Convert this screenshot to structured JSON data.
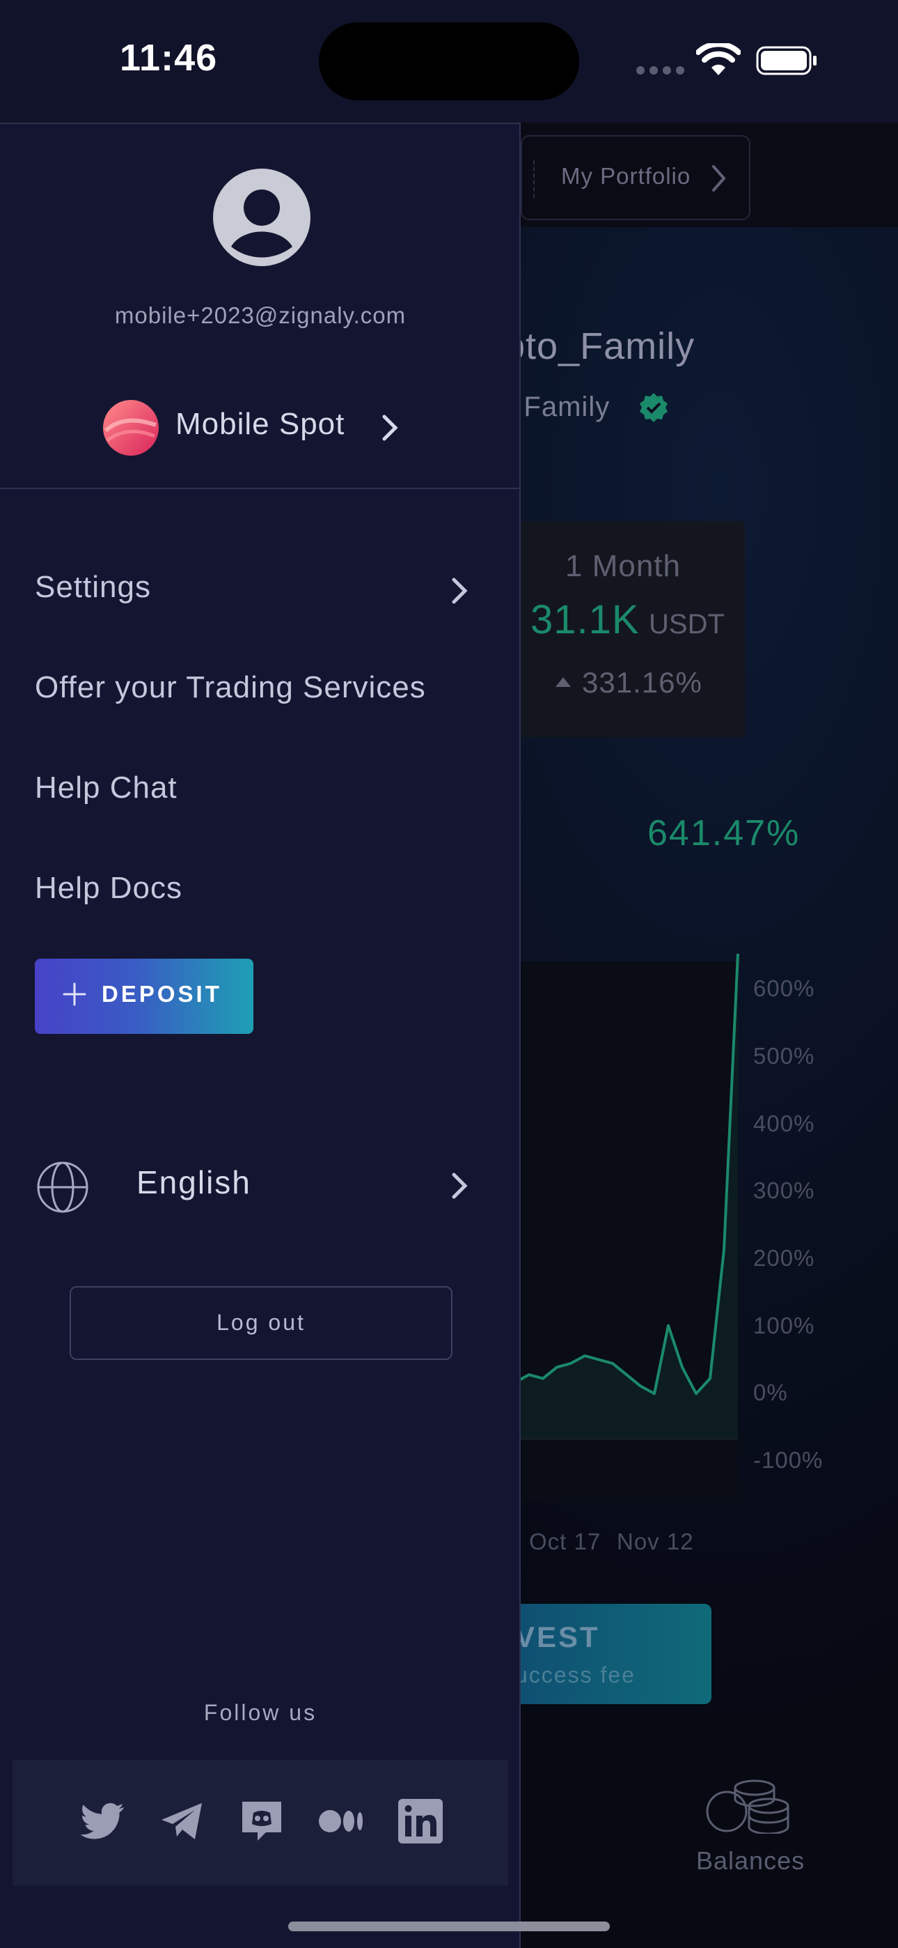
{
  "status_bar": {
    "time": "11:46"
  },
  "background": {
    "portfolio_label": "My Portfolio",
    "service_name": "pto_Family",
    "service_owner": "r Family",
    "month": {
      "title": "1 Month",
      "value": "31.1K",
      "unit": "USDT",
      "change": "331.16%"
    },
    "total_return": "641.47%",
    "chart_data": {
      "type": "line",
      "title": "",
      "xlabel": "",
      "ylabel": "",
      "x": [
        "Oct 17",
        "Nov 12"
      ],
      "y_ticks": [
        "600%",
        "500%",
        "400%",
        "300%",
        "200%",
        "100%",
        "0%",
        "-100%"
      ],
      "ylim": [
        -100,
        641.47
      ],
      "series": [
        {
          "values": [
            2,
            5,
            -1,
            3,
            0,
            8,
            4,
            -2,
            10,
            25,
            35,
            50,
            45,
            60,
            70,
            75,
            85,
            80,
            95,
            100,
            110,
            105,
            100,
            85,
            70,
            60,
            150,
            95,
            60,
            80,
            250,
            641.47
          ]
        }
      ],
      "grid": false,
      "color": "#1b8a6a"
    },
    "invest_label": "VEST",
    "invest_sub": "uccess fee",
    "balances_label": "Balances"
  },
  "drawer": {
    "email": "mobile+2023@zignaly.com",
    "account_name": "Mobile Spot",
    "menu": {
      "settings": "Settings",
      "offer": "Offer your Trading Services",
      "help_chat": "Help Chat",
      "help_docs": "Help Docs"
    },
    "deposit_label": "DEPOSIT",
    "language": "English",
    "logout": "Log out",
    "follow_us": "Follow us",
    "social_icons": [
      "twitter-icon",
      "telegram-icon",
      "discord-icon",
      "medium-icon",
      "linkedin-icon"
    ]
  },
  "colors": {
    "accent_green": "#1b8a6a",
    "drawer_bg": "#141631",
    "deposit_gradient_start": "#4742c7",
    "deposit_gradient_end": "#1e9fb3"
  }
}
